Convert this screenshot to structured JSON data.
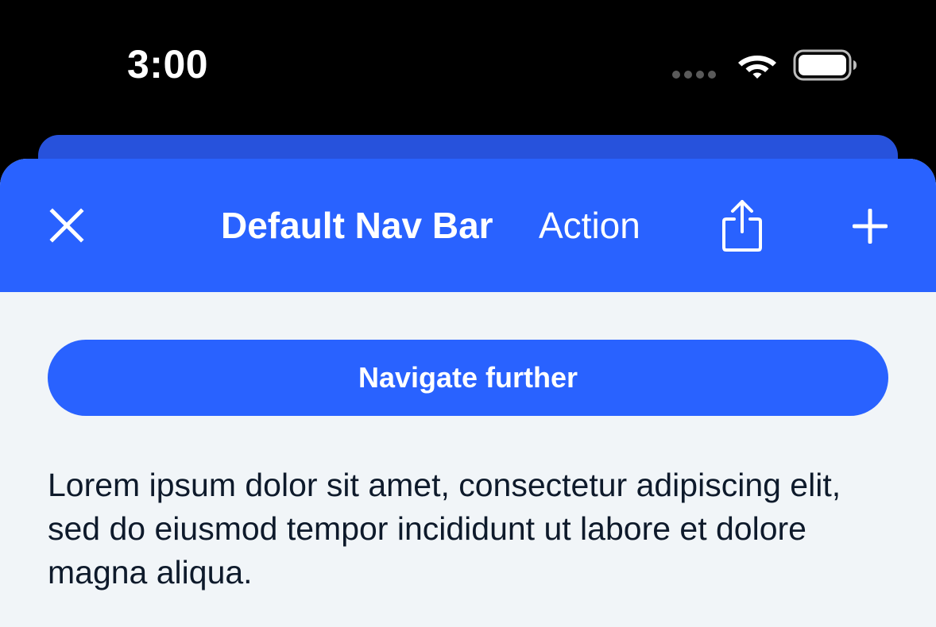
{
  "status_bar": {
    "time": "3:00",
    "icons": [
      "signal-dots-icon",
      "wifi-icon",
      "battery-icon"
    ]
  },
  "nav_bar": {
    "title": "Default Nav Bar",
    "action_label": "Action",
    "left_icon": "close-icon",
    "right_icons": [
      "share-icon",
      "plus-icon"
    ],
    "background_color": "#2962ff"
  },
  "main": {
    "primary_button_label": "Navigate further",
    "body_text": "Lorem ipsum dolor sit amet, consectetur adipiscing elit, sed do eiusmod tempor incididunt ut labore et dolore magna aliqua."
  },
  "colors": {
    "accent": "#2962ff",
    "background": "#f1f5f8",
    "text": "#0e1a2b"
  }
}
